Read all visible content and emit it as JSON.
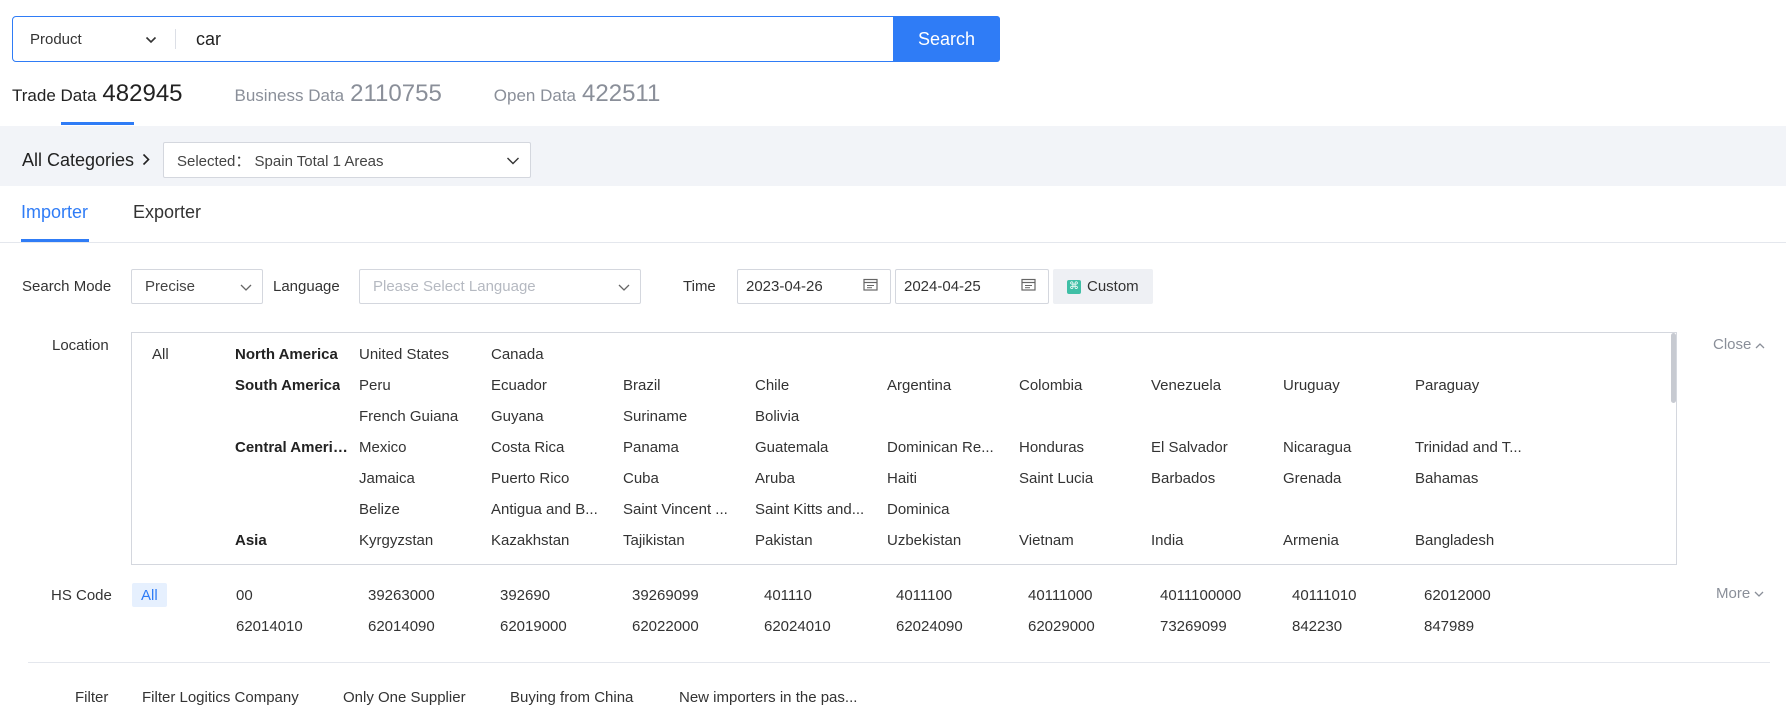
{
  "search": {
    "type_label": "Product",
    "query": "car",
    "button_label": "Search"
  },
  "data_tabs": [
    {
      "label": "Trade Data",
      "count": "482945"
    },
    {
      "label": "Business Data",
      "count": "2110755"
    },
    {
      "label": "Open Data",
      "count": "422511"
    }
  ],
  "categories": {
    "label": "All Categories",
    "selected": "Selected： Spain Total 1 Areas"
  },
  "role_tabs": [
    "Importer",
    "Exporter"
  ],
  "form": {
    "search_mode_label": "Search Mode",
    "search_mode_value": "Precise",
    "language_label": "Language",
    "language_placeholder": "Please Select Language",
    "time_label": "Time",
    "date_start": "2023-04-26",
    "date_end": "2024-04-25",
    "custom_label": "Custom"
  },
  "location": {
    "label": "Location",
    "all": "All",
    "close": "Close",
    "regions": [
      {
        "name": "North America",
        "rows": [
          [
            "United States",
            "Canada"
          ]
        ]
      },
      {
        "name": "South America",
        "rows": [
          [
            "Peru",
            "Ecuador",
            "Brazil",
            "Chile",
            "Argentina",
            "Colombia",
            "Venezuela",
            "Uruguay",
            "Paraguay"
          ],
          [
            "French Guiana",
            "Guyana",
            "Suriname",
            "Bolivia"
          ]
        ]
      },
      {
        "name": "Central Americ...",
        "rows": [
          [
            "Mexico",
            "Costa Rica",
            "Panama",
            "Guatemala",
            "Dominican Re...",
            "Honduras",
            "El Salvador",
            "Nicaragua",
            "Trinidad and T..."
          ],
          [
            "Jamaica",
            "Puerto Rico",
            "Cuba",
            "Aruba",
            "Haiti",
            "Saint Lucia",
            "Barbados",
            "Grenada",
            "Bahamas"
          ],
          [
            "Belize",
            "Antigua and B...",
            "Saint Vincent ...",
            "Saint Kitts and...",
            "Dominica"
          ]
        ]
      },
      {
        "name": "Asia",
        "rows": [
          [
            "Kyrgyzstan",
            "Kazakhstan",
            "Tajikistan",
            "Pakistan",
            "Uzbekistan",
            "Vietnam",
            "India",
            "Armenia",
            "Bangladesh"
          ]
        ]
      }
    ]
  },
  "hs_code": {
    "label": "HS Code",
    "all": "All",
    "more": "More",
    "rows": [
      [
        "00",
        "39263000",
        "392690",
        "39269099",
        "401110",
        "4011100",
        "40111000",
        "4011100000",
        "40111010",
        "62012000"
      ],
      [
        "62014010",
        "62014090",
        "62019000",
        "62022000",
        "62024010",
        "62024090",
        "62029000",
        "73269099",
        "842230",
        "847989"
      ]
    ]
  },
  "filter": {
    "label": "Filter",
    "items": [
      "Filter Logitics Company",
      "Only One Supplier",
      "Buying from China",
      "New importers in the pas..."
    ]
  },
  "colors": {
    "accent": "#2f7cf6",
    "band": "#f2f4f8"
  }
}
